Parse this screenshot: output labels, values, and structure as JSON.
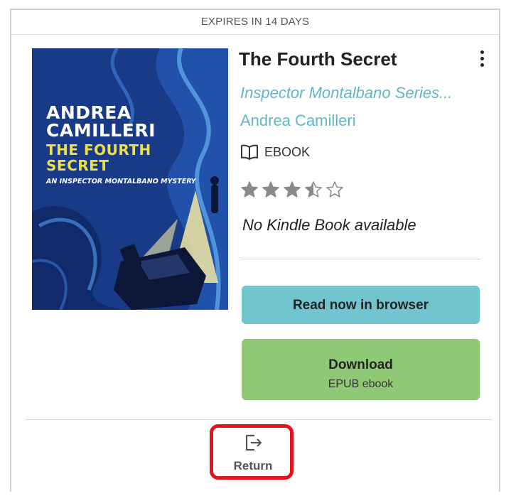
{
  "card": {
    "expires": "EXPIRES IN 14 DAYS"
  },
  "cover": {
    "author": "ANDREA\nCAMILLERI",
    "title": "THE FOURTH\nSECRET",
    "subtitle": "AN INSPECTOR MONTALBANO MYSTERY"
  },
  "book": {
    "title": "The Fourth Secret",
    "series": "Inspector Montalbano Series...",
    "author": "Andrea Camilleri",
    "format_icon": "open-book-icon",
    "format": "EBOOK",
    "rating": 3.5,
    "rating_max": 5,
    "kindle_status": "No Kindle Book available"
  },
  "actions": {
    "read_label": "Read now in browser",
    "download_label": "Download",
    "download_sub": "EPUB ebook",
    "return_icon": "return-exit-icon",
    "return_label": "Return"
  },
  "colors": {
    "link": "#5fb7c8",
    "read_button": "#72c4cf",
    "download_button": "#8fc975",
    "highlight": "#e3141b"
  }
}
